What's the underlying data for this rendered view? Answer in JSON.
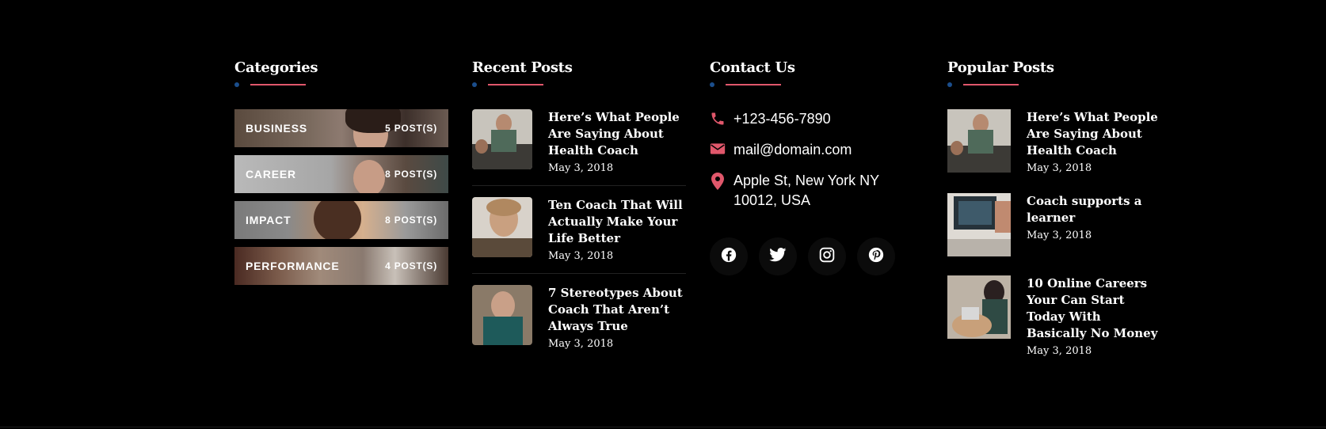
{
  "categories": {
    "title": "Categories",
    "items": [
      {
        "name": "BUSINESS",
        "count": "5 POST(S)"
      },
      {
        "name": "CAREER",
        "count": "8 POST(S)"
      },
      {
        "name": "IMPACT",
        "count": "8 POST(S)"
      },
      {
        "name": "PERFORMANCE",
        "count": "4 POST(S)"
      }
    ]
  },
  "recent_posts": {
    "title": "Recent Posts",
    "items": [
      {
        "title": "Here’s What People Are Saying About Health Coach",
        "date": "May 3, 2018"
      },
      {
        "title": "Ten Coach That Will Actually Make Your Life Better",
        "date": "May 3, 2018"
      },
      {
        "title": "7 Stereotypes About Coach That Aren’t Always True",
        "date": "May 3, 2018"
      }
    ]
  },
  "contact": {
    "title": "Contact Us",
    "phone": "+123-456-7890",
    "email": "mail@domain.com",
    "address": "Apple St, New York NY 10012, USA",
    "socials": [
      "facebook-icon",
      "twitter-icon",
      "instagram-icon",
      "pinterest-icon"
    ]
  },
  "popular_posts": {
    "title": "Popular Posts",
    "items": [
      {
        "title": "Here’s What People Are Saying About Health Coach",
        "date": "May 3, 2018"
      },
      {
        "title": "Coach supports a learner",
        "date": "May 3, 2018"
      },
      {
        "title": "10 Online Careers Your Can Start Today With Basically No Money",
        "date": "May 3, 2018"
      }
    ]
  },
  "colors": {
    "background": "#000000",
    "accent": "#e0576b",
    "dot": "#1b4e8c",
    "text": "#ffffff"
  }
}
